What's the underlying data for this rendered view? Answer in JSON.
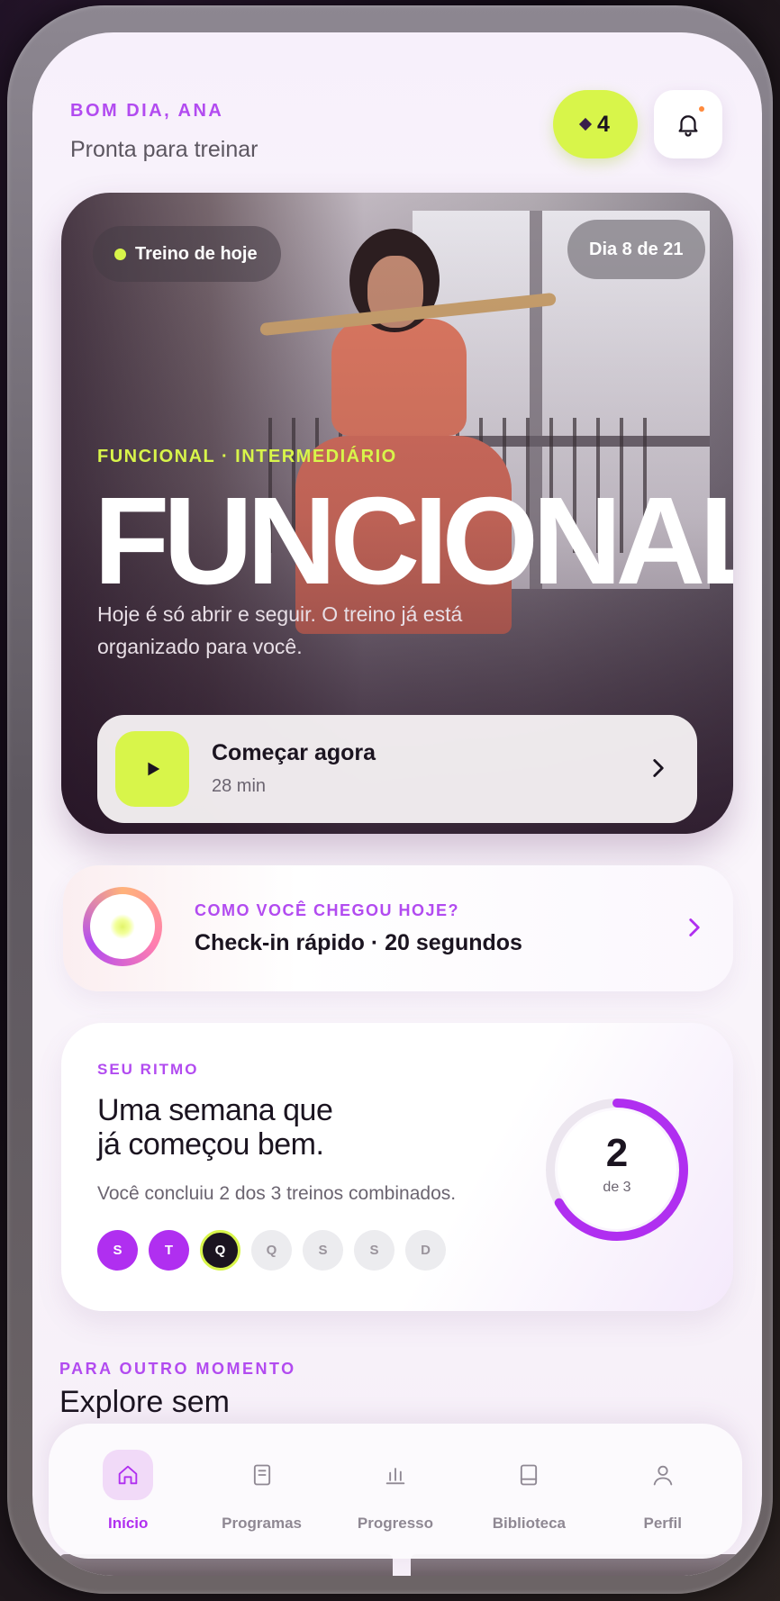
{
  "header": {
    "greeting": "BOM DIA, ANA",
    "subtitle": "Pronta para treinar",
    "streak_count": "4",
    "notification_icon": "bell-icon"
  },
  "hero": {
    "today_chip": "Treino de hoje",
    "day_chip": "Dia 8 de 21",
    "tag": "FUNCIONAL · INTERMEDIÁRIO",
    "title": "FUNCIONAL",
    "description": "Hoje é só abrir e seguir. O treino já está organizado para você.",
    "cta_label": "Começar agora",
    "cta_duration": "28 min"
  },
  "checkin": {
    "question": "COMO VOCÊ CHEGOU HOJE?",
    "title": "Check-in rápido · 20 segundos"
  },
  "rhythm": {
    "label": "SEU RITMO",
    "headline_line1": "Uma semana que",
    "headline_line2": "já começou bem.",
    "description": "Você concluiu 2 dos 3 treinos combinados.",
    "completed": "2",
    "goal_text": "de 3",
    "progress_fraction": 0.667,
    "days": [
      {
        "letter": "S",
        "state": "done"
      },
      {
        "letter": "T",
        "state": "done"
      },
      {
        "letter": "Q",
        "state": "today"
      },
      {
        "letter": "Q",
        "state": "todo"
      },
      {
        "letter": "S",
        "state": "todo"
      },
      {
        "letter": "S",
        "state": "todo"
      },
      {
        "letter": "D",
        "state": "todo"
      }
    ]
  },
  "explore": {
    "label": "PARA OUTRO MOMENTO",
    "title": "Explore sem"
  },
  "nav": {
    "items": [
      {
        "label": "Início",
        "icon": "home-icon",
        "active": true
      },
      {
        "label": "Programas",
        "icon": "book-icon",
        "active": false
      },
      {
        "label": "Progresso",
        "icon": "bar-chart-icon",
        "active": false
      },
      {
        "label": "Biblioteca",
        "icon": "library-icon",
        "active": false
      },
      {
        "label": "Perfil",
        "icon": "user-icon",
        "active": false
      }
    ]
  },
  "colors": {
    "accent": "#b02ff0",
    "lime": "#d8f54a",
    "dark": "#1b1420"
  }
}
